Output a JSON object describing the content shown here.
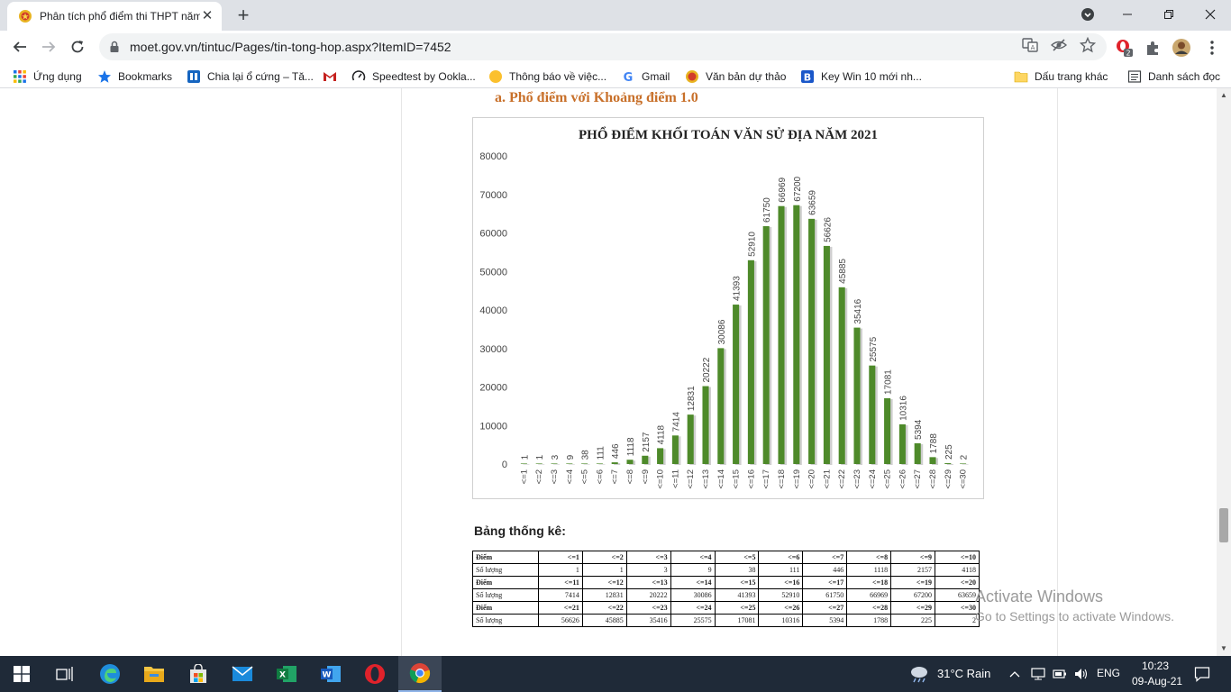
{
  "browser": {
    "tab": {
      "title": "Phân tích phổ điểm thi THPT năm"
    },
    "url": "moet.gov.vn/tintuc/Pages/tin-tong-hop.aspx?ItemID=7452",
    "extension_badge": "2"
  },
  "bookmarks": [
    {
      "label": "Ứng dụng",
      "icon": "apps-grid-icon"
    },
    {
      "label": "Bookmarks",
      "icon": "star-icon"
    },
    {
      "label": "Chia lại ổ cứng – Tă...",
      "icon": "site-icon"
    },
    {
      "label": "",
      "icon": "gmail-icon"
    },
    {
      "label": "Speedtest by Ookla...",
      "icon": "speedtest-icon"
    },
    {
      "label": "Thông báo về việc...",
      "icon": "notice-icon"
    },
    {
      "label": "Gmail",
      "icon": "google-icon"
    },
    {
      "label": "Văn bản dự thảo",
      "icon": "emblem-icon"
    },
    {
      "label": "Key Win 10 mới nh...",
      "icon": "b-icon"
    }
  ],
  "bookmarks_right": [
    {
      "label": "Dấu trang khác",
      "icon": "folder-icon"
    },
    {
      "label": "Danh sách đọc",
      "icon": "reading-list-icon"
    }
  ],
  "page": {
    "section_heading": "a. Phổ điểm với Khoảng điểm 1.0",
    "stats_label": "Bảng thống kê:",
    "table": {
      "row_label_score": "Điểm",
      "row_label_count": "Số lượng",
      "blocks": [
        {
          "scores": [
            "<=1",
            "<=2",
            "<=3",
            "<=4",
            "<=5",
            "<=6",
            "<=7",
            "<=8",
            "<=9",
            "<=10"
          ],
          "counts": [
            "1",
            "1",
            "3",
            "9",
            "38",
            "111",
            "446",
            "1118",
            "2157",
            "4118"
          ]
        },
        {
          "scores": [
            "<=11",
            "<=12",
            "<=13",
            "<=14",
            "<=15",
            "<=16",
            "<=17",
            "<=18",
            "<=19",
            "<=20"
          ],
          "counts": [
            "7414",
            "12831",
            "20222",
            "30086",
            "41393",
            "52910",
            "61750",
            "66969",
            "67200",
            "63659"
          ]
        },
        {
          "scores": [
            "<=21",
            "<=22",
            "<=23",
            "<=24",
            "<=25",
            "<=26",
            "<=27",
            "<=28",
            "<=29",
            "<=30"
          ],
          "counts": [
            "56626",
            "45885",
            "35416",
            "25575",
            "17081",
            "10316",
            "5394",
            "1788",
            "225",
            "2"
          ]
        }
      ]
    },
    "watermark": {
      "line1": "Activate Windows",
      "line2": "Go to Settings to activate Windows."
    }
  },
  "chart_data": {
    "type": "bar",
    "title": "PHỔ ĐIỂM KHỐI TOÁN VĂN SỬ ĐỊA NĂM 2021",
    "categories": [
      "<=1",
      "<=2",
      "<=3",
      "<=4",
      "<=5",
      "<=6",
      "<=7",
      "<=8",
      "<=9",
      "<=10",
      "<=11",
      "<=12",
      "<=13",
      "<=14",
      "<=15",
      "<=16",
      "<=17",
      "<=18",
      "<=19",
      "<=20",
      "<=21",
      "<=22",
      "<=23",
      "<=24",
      "<=25",
      "<=26",
      "<=27",
      "<=28",
      "<=29",
      "<=30"
    ],
    "values": [
      1,
      1,
      3,
      9,
      38,
      111,
      446,
      1118,
      2157,
      4118,
      7414,
      12831,
      20222,
      30086,
      41393,
      52910,
      61750,
      66969,
      67200,
      63659,
      56626,
      45885,
      35416,
      25575,
      17081,
      10316,
      5394,
      1788,
      225,
      2
    ],
    "yticks": [
      0,
      10000,
      20000,
      30000,
      40000,
      50000,
      60000,
      70000,
      80000
    ],
    "ylim": [
      0,
      80000
    ],
    "bar_color": "#4e8a2a",
    "xlabel": "",
    "ylabel": ""
  },
  "taskbar": {
    "weather": "31°C  Rain",
    "lang": "ENG",
    "time": "10:23",
    "date": "09-Aug-21"
  }
}
